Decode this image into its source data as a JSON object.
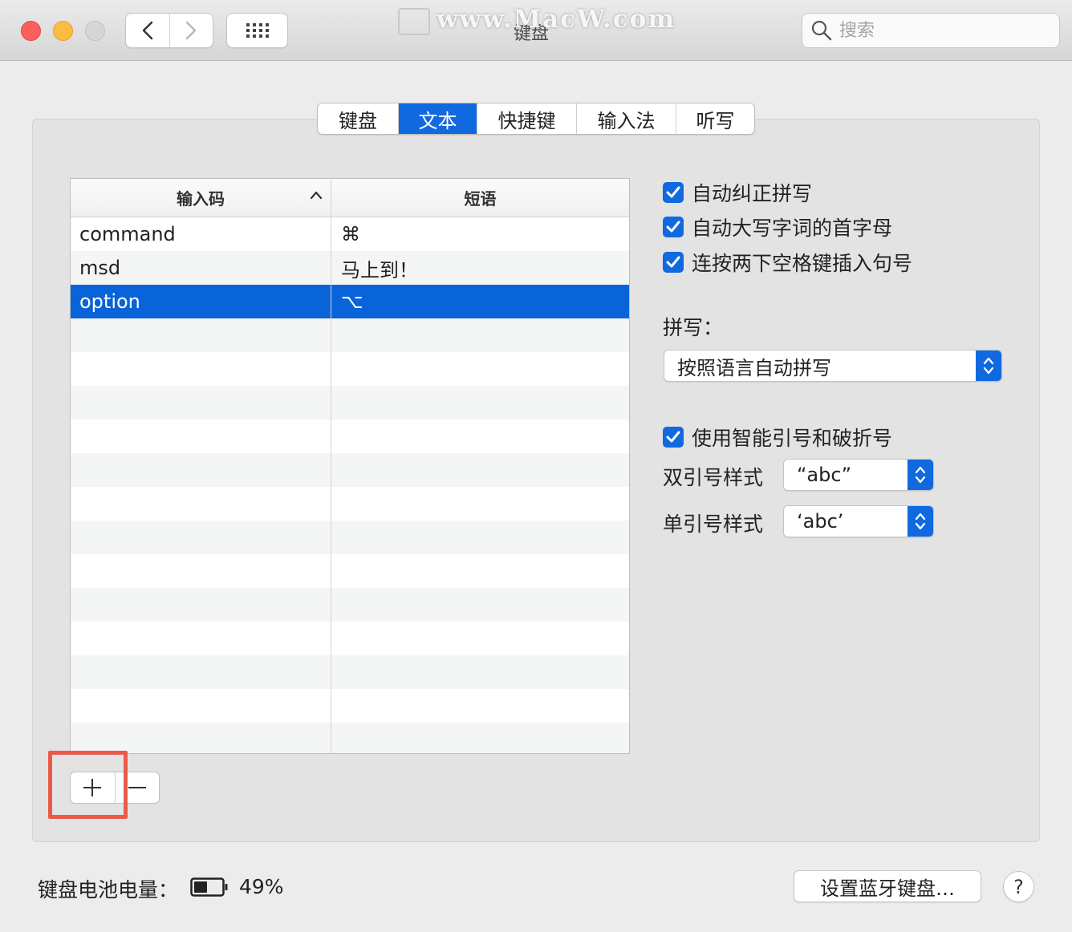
{
  "window": {
    "title": "键盘",
    "watermark": "www.MacW.com"
  },
  "search": {
    "placeholder": "搜索",
    "value": ""
  },
  "tabs": [
    {
      "label": "键盘",
      "active": false
    },
    {
      "label": "文本",
      "active": true
    },
    {
      "label": "快捷键",
      "active": false
    },
    {
      "label": "输入法",
      "active": false
    },
    {
      "label": "听写",
      "active": false
    }
  ],
  "table": {
    "headers": [
      "输入码",
      "短语"
    ],
    "rows": [
      {
        "code": "command",
        "phrase": "⌘",
        "selected": false
      },
      {
        "code": "msd",
        "phrase": "马上到！",
        "selected": false
      },
      {
        "code": "option",
        "phrase": "⌥",
        "selected": true
      }
    ]
  },
  "table_buttons": {
    "add": "+",
    "remove": "−"
  },
  "options": {
    "auto_correct": {
      "label": "自动纠正拼写",
      "checked": true
    },
    "auto_capitalize": {
      "label": "自动大写字词的首字母",
      "checked": true
    },
    "double_space_period": {
      "label": "连按两下空格键插入句号",
      "checked": true
    },
    "spelling_label": "拼写：",
    "spelling_value": "按照语言自动拼写",
    "smart_quotes": {
      "label": "使用智能引号和破折号",
      "checked": true
    },
    "double_quote_label": "双引号样式",
    "double_quote_value": "“abc”",
    "single_quote_label": "单引号样式",
    "single_quote_value": "‘abc’"
  },
  "footer": {
    "battery_label": "键盘电池电量：",
    "battery_percent": "49%",
    "battery_level": 0.49,
    "bluetooth_button": "设置蓝牙键盘…",
    "help": "?"
  },
  "colors": {
    "accent": "#1169e0",
    "selection": "#0963d9",
    "highlight": "#ea5a4a"
  }
}
